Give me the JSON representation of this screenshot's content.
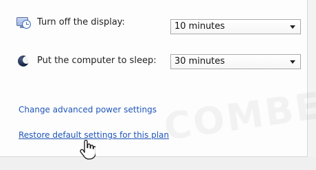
{
  "settings": {
    "display": {
      "icon": "monitor-clock-icon",
      "label": "Turn off the display:",
      "selected": "10 minutes"
    },
    "sleep": {
      "icon": "sleep-moon-icon",
      "label": "Put the computer to sleep:",
      "selected": "30 minutes"
    }
  },
  "links": {
    "advanced": "Change advanced power settings",
    "restore": "Restore default settings for this plan"
  },
  "watermark": "COMBE",
  "colors": {
    "link": "#1f55b8",
    "border": "#a9a9a9",
    "background": "#fdfdfd"
  }
}
